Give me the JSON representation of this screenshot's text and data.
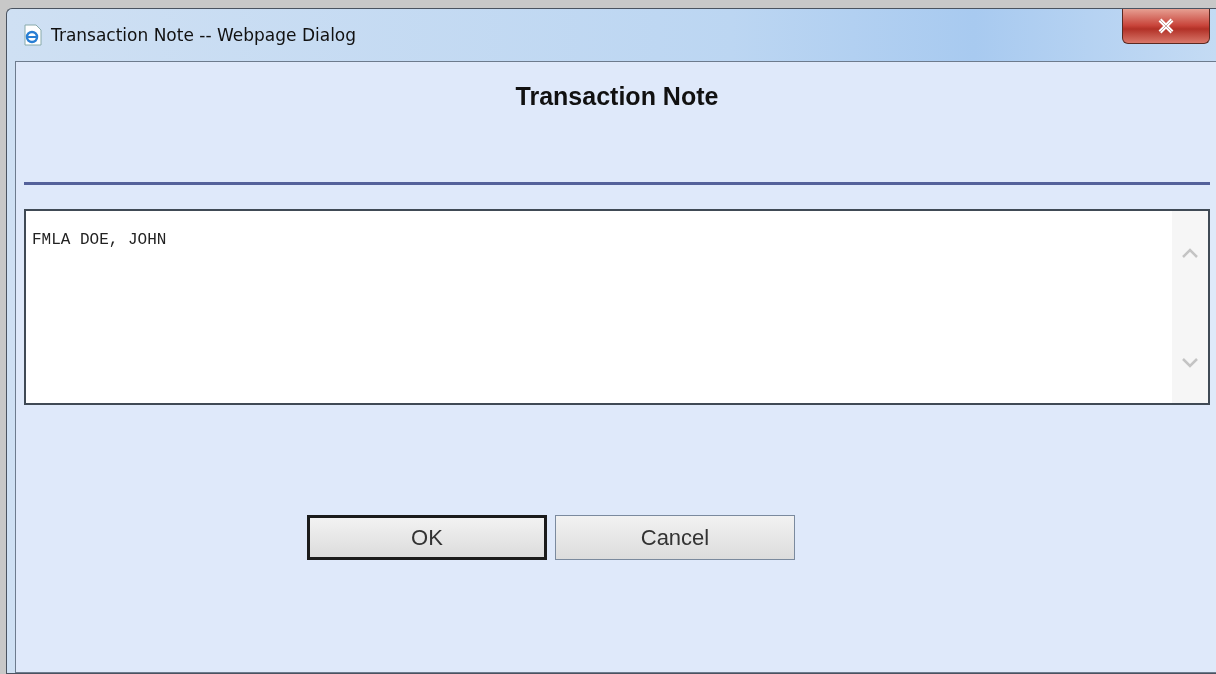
{
  "window": {
    "title": "Transaction Note -- Webpage Dialog"
  },
  "heading": "Transaction Note",
  "note": {
    "value": "FMLA DOE, JOHN"
  },
  "buttons": [
    {
      "label": "OK",
      "default": true
    },
    {
      "label": "Cancel",
      "default": false
    }
  ]
}
